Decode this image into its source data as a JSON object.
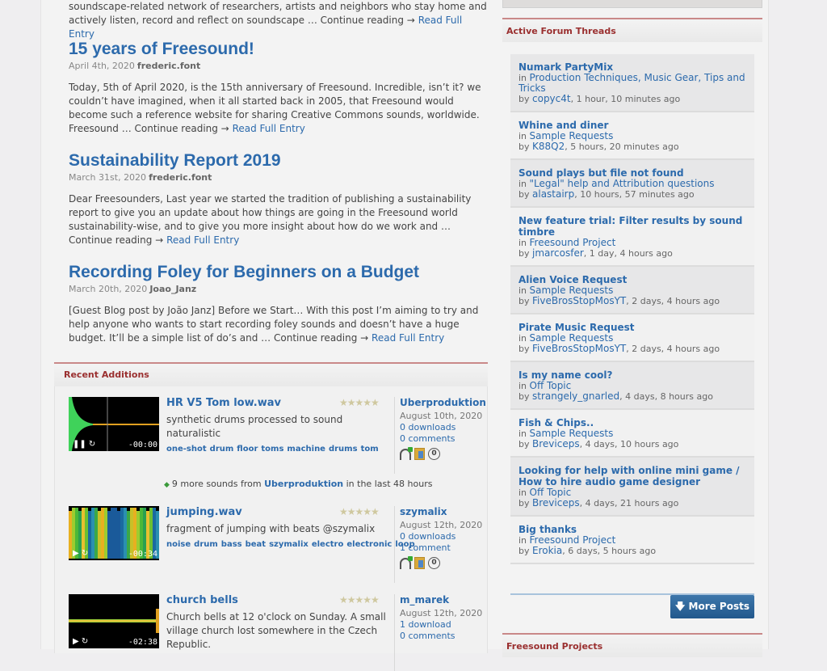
{
  "blog": {
    "intro_text": "soundscape-related network of researchers, artists and neighbors who stay home and actively listen, record and reflect on soundscape … Continue reading →",
    "read_full": "Read Full Entry",
    "posts": [
      {
        "title": "15 years of Freesound!",
        "date": "April 4th, 2020",
        "author": "frederic.font",
        "excerpt": "Today, 5th of April 2020, is the 15th anniversary of Freesound. Incredible, isn’t it? we couldn’t have imagined, when it all started back in 2005, that Freesound would become such a reference website for sharing Creative Commons sounds, worldwide. Freesound … Continue reading →"
      },
      {
        "title": "Sustainability Report 2019",
        "date": "March 31st, 2020",
        "author": "frederic.font",
        "excerpt": "Dear Freesounders, Last year we started the tradition of publishing a sustainability report to give you an update about how things are going in the Freesound world sustainability-wise, and to give you more insight about how do we work and … Continue reading →"
      },
      {
        "title": "Recording Foley for Beginners on a Budget",
        "date": "March 20th, 2020",
        "author": "Joao_Janz",
        "excerpt": "[Guest Blog post by João Janz] Before we Start… With this post I’m aiming to try and help anyone who wants to start recording foley sounds and doesn’t have a huge budget. It’ll be a simple list of do’s and … Continue reading →"
      }
    ]
  },
  "recent_additions": {
    "heading": "Recent Additions",
    "more_from": {
      "prefix": "9 more sounds from",
      "user": "Uberproduktion",
      "suffix": "in the last 48 hours"
    },
    "sounds": [
      {
        "title": "HR V5 Tom low.wav",
        "description": "synthetic drums processed to sound naturalistic",
        "tags": [
          "one-shot",
          "drum",
          "floor",
          "toms",
          "machine",
          "drums",
          "tom"
        ],
        "user": "Uberproduktion",
        "date": "August 10th, 2020",
        "downloads": "0 downloads",
        "comments": "0 comments",
        "time": "-00:00",
        "play_state": "pause",
        "rating_stars": 0
      },
      {
        "title": "jumping.wav",
        "description": "fragment of jumping with beats @szymalix",
        "tags": [
          "noise",
          "drum",
          "bass",
          "beat",
          "szymalix",
          "electro",
          "electronic",
          "loop"
        ],
        "user": "szymalix",
        "date": "August 12th, 2020",
        "downloads": "0 downloads",
        "comments": "1 comment",
        "time": "-00:34",
        "play_state": "play",
        "rating_stars": 0
      },
      {
        "title": "church bells",
        "description": "Church bells at 12 o'clock on Sunday. A small village church lost somewhere in the Czech Republic.",
        "tags": [],
        "user": "m_marek",
        "date": "August 12th, 2020",
        "downloads": "1 download",
        "comments": "0 comments",
        "time": "-02:38",
        "play_state": "play",
        "rating_stars": 0
      }
    ]
  },
  "forum": {
    "heading": "Active Forum Threads",
    "in_label": "in",
    "by_label": "by",
    "threads": [
      {
        "title": "Numark PartyMix",
        "forum": "Production Techniques, Music Gear, Tips and Tricks",
        "user": "copyc4t",
        "ago": ", 1 hour, 10 minutes ago"
      },
      {
        "title": "Whine and diner",
        "forum": "Sample Requests",
        "user": "K88Q2",
        "ago": ", 5 hours, 20 minutes ago"
      },
      {
        "title": "Sound plays but file not found",
        "forum": "\"Legal\" help and Attribution questions",
        "user": "alastairp",
        "ago": ", 10 hours, 57 minutes ago"
      },
      {
        "title": "New feature trial: Filter results by sound timbre",
        "forum": "Freesound Project",
        "user": "jmarcosfer",
        "ago": ", 1 day, 4 hours ago"
      },
      {
        "title": "Alien Voice Request",
        "forum": "Sample Requests",
        "user": "FiveBrosStopMosYT",
        "ago": ", 2 days, 4 hours ago"
      },
      {
        "title": "Pirate Music Request",
        "forum": "Sample Requests",
        "user": "FiveBrosStopMosYT",
        "ago": ", 2 days, 4 hours ago"
      },
      {
        "title": "Is my name cool?",
        "forum": "Off Topic",
        "user": "strangely_gnarled",
        "ago": ", 4 days, 8 hours ago"
      },
      {
        "title": "Fish & Chips..",
        "forum": "Sample Requests",
        "user": "Breviceps",
        "ago": ", 4 days, 10 hours ago"
      },
      {
        "title": "Looking for help with online mini game / How to hire audio game designer",
        "forum": "Off Topic",
        "user": "Breviceps",
        "ago": ", 4 days, 21 hours ago"
      },
      {
        "title": "Big thanks",
        "forum": "Freesound Project",
        "user": "Erokia",
        "ago": ", 6 days, 5 hours ago"
      }
    ],
    "more_posts": "🡇 More Posts"
  },
  "projects": {
    "heading": "Freesound Projects"
  },
  "colors": {
    "link": "#2c6aac",
    "section_heading": "#9a2f2f",
    "section_rule": "#c98888",
    "button": "#2a628f"
  }
}
